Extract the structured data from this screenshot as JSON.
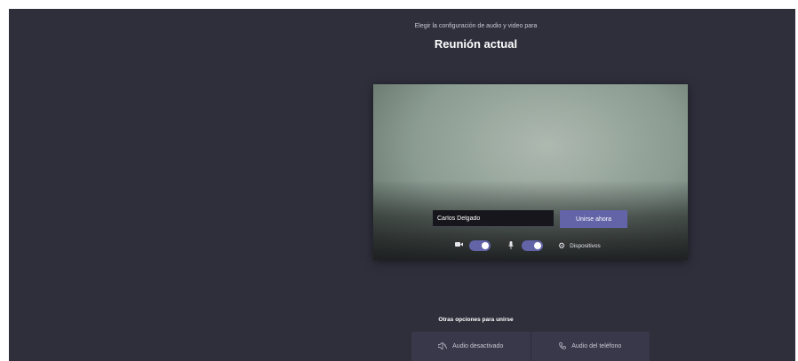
{
  "header": {
    "subtitle": "Elegir la configuración de audio y video para",
    "title": "Reunión actual"
  },
  "prejoin": {
    "name_value": "Carlos Delgado",
    "join_label": "Unirse ahora",
    "camera": {
      "icon": "video-camera-icon",
      "on": true
    },
    "microphone": {
      "icon": "microphone-icon",
      "on": true
    },
    "devices_label": "Dispositivos"
  },
  "other_options": {
    "label": "Otras opciones para unirse",
    "items": [
      {
        "icon": "speaker-off-icon",
        "label": "Audio desactivado"
      },
      {
        "icon": "phone-icon",
        "label": "Audio del teléfono"
      }
    ]
  },
  "colors": {
    "background": "#2f2f3c",
    "accent": "#6264a7"
  }
}
